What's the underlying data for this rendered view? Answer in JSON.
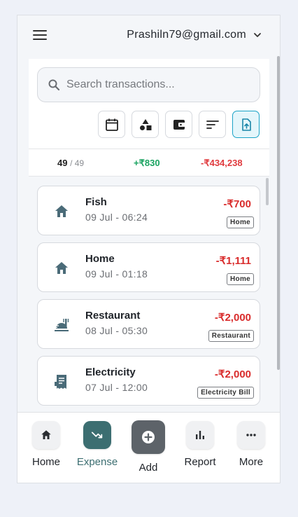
{
  "header": {
    "account_email": "Prashiln79@gmail.com"
  },
  "search": {
    "placeholder": "Search transactions..."
  },
  "filters": {
    "icons": [
      "calendar-icon",
      "category-icon",
      "wallet-icon",
      "sort-icon",
      "export-icon"
    ]
  },
  "summary": {
    "count": "49",
    "total": "/ 49",
    "income": "+₹830",
    "expense": "-₹434,238"
  },
  "colors": {
    "income": "#1aa361",
    "expense": "#d92c2c",
    "accent": "#3c6e71",
    "active_filter": "#1aa3c7"
  },
  "transactions": [
    {
      "title": "Fish",
      "date": "09 Jul - 06:24",
      "amount": "-₹700",
      "category": "Home",
      "icon": "home-icon"
    },
    {
      "title": "Home",
      "date": "09 Jul - 01:18",
      "amount": "-₹1,111",
      "category": "Home",
      "icon": "home-icon"
    },
    {
      "title": "Restaurant",
      "date": "08 Jul - 05:30",
      "amount": "-₹2,000",
      "category": "Restaurant",
      "icon": "restaurant-icon"
    },
    {
      "title": "Electricity",
      "date": "07 Jul - 12:00",
      "amount": "-₹2,000",
      "category": "Electricity Bill",
      "icon": "bill-icon"
    }
  ],
  "nav": {
    "home": "Home",
    "expense": "Expense",
    "add": "Add",
    "report": "Report",
    "more": "More"
  }
}
